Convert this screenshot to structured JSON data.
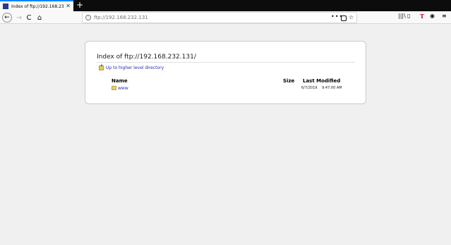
{
  "tab": {
    "title": "Index of ftp://192.168.232.131/",
    "close_glyph": "✕",
    "new_tab_glyph": "+"
  },
  "navbar": {
    "back_glyph": "←",
    "forward_glyph": "→",
    "reload_glyph": "C",
    "home_glyph": "⌂",
    "url": "ftp://192.168.232.131",
    "page_actions_glyph": "•••",
    "bookmark_glyph": "☆",
    "library_glyph": "|||\\",
    "sidebar_glyph": "▯",
    "tool_glyph": "T",
    "account_glyph": "◉",
    "menu_glyph": "≡"
  },
  "listing": {
    "heading": "Index of ftp://192.168.232.131/",
    "up_link": "Up to higher level directory",
    "columns": {
      "name": "Name",
      "size": "Size",
      "modified": "Last Modified"
    },
    "entries": [
      {
        "name": "www",
        "size": "",
        "date": "6/7/2019",
        "time": "9:47:00 AM"
      }
    ]
  },
  "icons": {
    "tab": "page-icon",
    "back": "back-arrow-icon",
    "forward": "forward-arrow-icon",
    "reload": "reload-icon",
    "home": "home-icon",
    "info": "info-icon",
    "page_actions": "more-icon",
    "pocket": "pocket-icon",
    "bookmark": "star-icon",
    "library": "library-icon",
    "sidebar": "sidebar-icon",
    "tool": "extension-icon",
    "account": "account-icon",
    "menu": "hamburger-icon",
    "up": "up-folder-icon",
    "entry": "folder-icon"
  },
  "colors": {
    "accent": "#0a84ff",
    "link": "#2a2ab0",
    "folder": "#e8cf6e"
  }
}
